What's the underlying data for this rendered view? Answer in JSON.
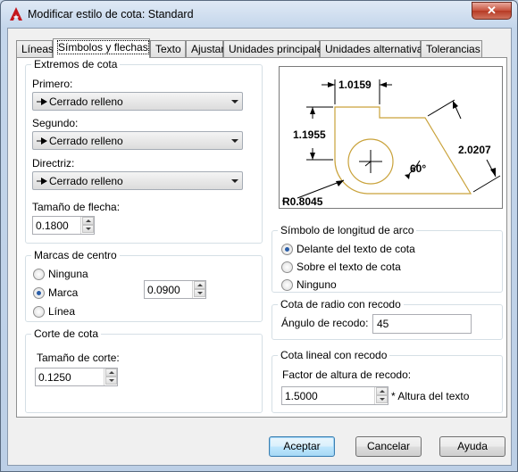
{
  "window": {
    "title": "Modificar estilo de cota: Standard",
    "close": "✕"
  },
  "tabs": [
    "Líneas",
    "Símbolos y flechas",
    "Texto",
    "Ajustar",
    "Unidades principales",
    "Unidades alternativas",
    "Tolerancias"
  ],
  "extremos": {
    "title": "Extremos de cota",
    "primero_label": "Primero:",
    "primero_value": "Cerrado relleno",
    "segundo_label": "Segundo:",
    "segundo_value": "Cerrado relleno",
    "directriz_label": "Directriz:",
    "directriz_value": "Cerrado relleno",
    "tamano_label": "Tamaño de flecha:",
    "tamano_value": "0.1800"
  },
  "marcas": {
    "title": "Marcas de centro",
    "ninguna": "Ninguna",
    "marca": "Marca",
    "linea": "Línea",
    "selected": "marca",
    "size_value": "0.0900"
  },
  "corte": {
    "title": "Corte de cota",
    "tamano_label": "Tamaño de corte:",
    "tamano_value": "0.1250"
  },
  "preview": {
    "dim_top": "1.0159",
    "dim_left": "1.1955",
    "dim_right": "2.0207",
    "angle": "60°",
    "radius": "R0.8045"
  },
  "arco": {
    "title": "Símbolo de longitud de arco",
    "delante": "Delante del texto de cota",
    "sobre": "Sobre el texto de cota",
    "ninguno": "Ninguno",
    "selected": "delante"
  },
  "radio_recodo": {
    "title": "Cota de radio con recodo",
    "angulo_label": "Ángulo de recodo:",
    "angulo_value": "45"
  },
  "lineal_recodo": {
    "title": "Cota lineal con recodo",
    "factor_label": "Factor de altura de recodo:",
    "factor_value": "1.5000",
    "suffix": "* Altura del texto"
  },
  "buttons": {
    "accept": "Aceptar",
    "cancel": "Cancelar",
    "help": "Ayuda"
  },
  "colors": {
    "preview_lines": "#000000",
    "preview_shape": "#c9a23a"
  }
}
